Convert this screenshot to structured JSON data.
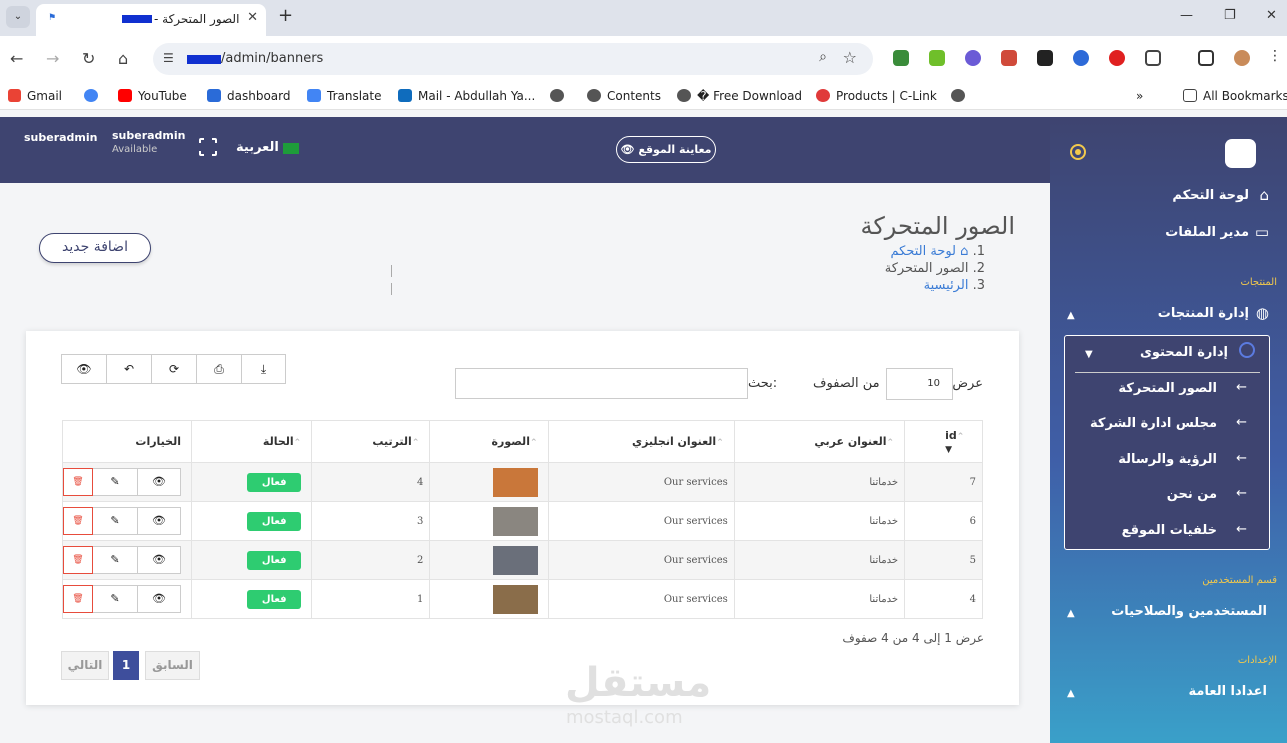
{
  "browser": {
    "tab_title": "الصور المتحركة -",
    "url": "/admin/banners",
    "bookmarks": [
      "Gmail",
      "YouTube",
      "dashboard",
      "Translate",
      "Mail - Abdullah Ya...",
      "Contents",
      "� Free Download",
      "Products | C-Link"
    ],
    "all_bookmarks": "All Bookmarks"
  },
  "header": {
    "avatar_alt": "suberadmin",
    "user_name": "suberadmin",
    "user_status": "Available",
    "language": "العربية",
    "preview_site": "معاينة الموقع"
  },
  "sidebar": {
    "dashboard": "لوحة التحكم",
    "file_manager": "مدير الملفات",
    "section_products": "المنتجات",
    "products_mgmt": "إدارة المنتجات",
    "content_mgmt": "إدارة المحتوى",
    "submenu": [
      "الصور المتحركة",
      "مجلس ادارة الشركة",
      "الرؤية والرسالة",
      "من نحن",
      "خلفيات الموقع"
    ],
    "section_users": "قسم المستخدمين",
    "users_perms": "المستخدمين والصلاحيات",
    "section_settings": "الإعدادات",
    "general_settings": "اعدادا العامة"
  },
  "page": {
    "title": "الصور المتحركة",
    "breadcrumb": [
      {
        "num": "1.",
        "label": "لوحة التحكم"
      },
      {
        "num": "2.",
        "label": "الصور المتحركة"
      },
      {
        "num": "3.",
        "label": "الرئيسية"
      }
    ],
    "add_new": "اضافة جديد"
  },
  "table_controls": {
    "show": "عرض",
    "page_length": "10",
    "rows_label": "من الصفوف",
    "search": "بحث:"
  },
  "table": {
    "columns": [
      "id",
      "العنوان عربي",
      "العنوان انجليزي",
      "الصورة",
      "الترتيب",
      "الحالة",
      "الخيارات"
    ],
    "rows": [
      {
        "id": "7",
        "title_ar": "خدماتنا",
        "title_en": "Our services",
        "order": "4",
        "status": "فعال",
        "img_color": "#c9773a"
      },
      {
        "id": "6",
        "title_ar": "خدماتنا",
        "title_en": "Our services",
        "order": "3",
        "status": "فعال",
        "img_color": "#8a8680"
      },
      {
        "id": "5",
        "title_ar": "خدماتنا",
        "title_en": "Our services",
        "order": "2",
        "status": "فعال",
        "img_color": "#6a6f7a"
      },
      {
        "id": "4",
        "title_ar": "خدماتنا",
        "title_en": "Our services",
        "order": "1",
        "status": "فعال",
        "img_color": "#8a6d4a"
      }
    ]
  },
  "footer": {
    "info": "عرض 1 إلى 4 من 4 صفوف",
    "prev": "السابق",
    "page": "1",
    "next": "التالي"
  },
  "watermark": {
    "ar": "مستقل",
    "en": "mostaql.com"
  }
}
